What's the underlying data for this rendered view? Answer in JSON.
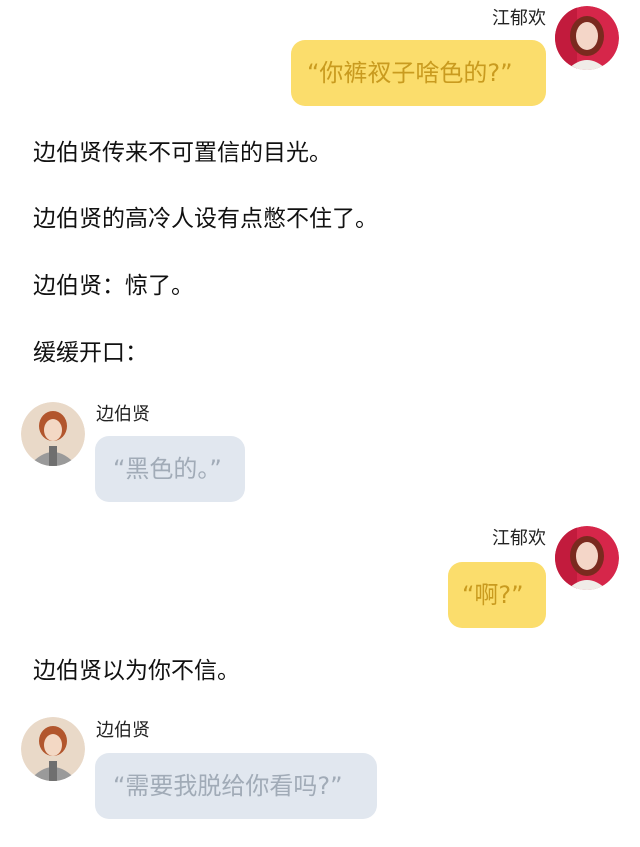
{
  "messages": [
    {
      "sender": "江郁欢",
      "text": "“你裤衩子啥色的?”"
    },
    {
      "sender": "边伯贤",
      "text": "“黑色的。”"
    },
    {
      "sender": "江郁欢",
      "text": "“啊?”"
    },
    {
      "sender": "边伯贤",
      "text": "“需要我脱给你看吗?”"
    }
  ],
  "narration": [
    "边伯贤传来不可置信的目光。",
    "边伯贤的高冷人设有点憋不住了。",
    "边伯贤：惊了。",
    "缓缓开口：",
    "边伯贤以为你不信。"
  ],
  "avatars": {
    "jiang": "female-avatar-icon",
    "bian": "male-avatar-icon"
  },
  "colors": {
    "bubble_yellow": "#fbdd6c",
    "bubble_yellow_text": "#c99b1f",
    "bubble_grey": "#e1e7ef",
    "bubble_grey_text": "#a1abb7"
  }
}
